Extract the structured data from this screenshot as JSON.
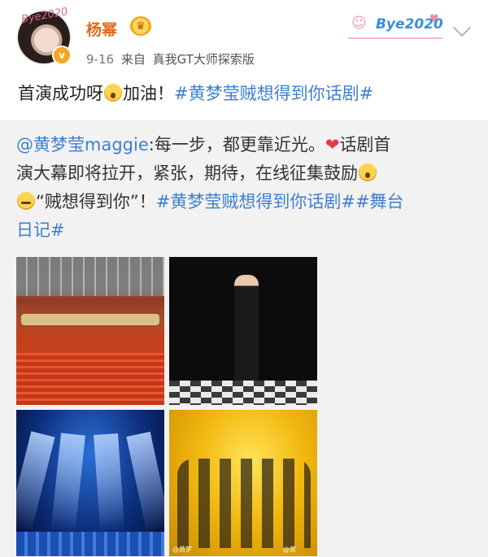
{
  "header": {
    "username": "杨幂",
    "date": "9-16",
    "source_prefix": "来自",
    "source": "真我GT大师探索版",
    "avatar_signature": "Bye2020",
    "verified_mark": "v",
    "decoration_text": "Bye2020"
  },
  "post": {
    "text_a": "首演成功呀",
    "text_b": "加油！",
    "hashtag": "#黄梦莹贼想得到你话剧#"
  },
  "repost": {
    "mention": "@黄梦莹maggie",
    "line1_text": ":每一步，都更靠近光。",
    "line1_tail": "话剧首",
    "line2_text": "演大幕即将拉开，紧张，期待，在线征集鼓励",
    "line3_text": "“贼想得到你”！",
    "line3_tag": "#黄梦莹贼想得到你话剧##舞台",
    "line4_tag": "日记#",
    "watermark_1": "@黄梦",
    "watermark_2": "@黄"
  },
  "colors": {
    "accent_link": "#3d7fd1",
    "username": "#e06a1a",
    "repost_bg": "#f2f2f2",
    "heart": "#e23b4a"
  }
}
